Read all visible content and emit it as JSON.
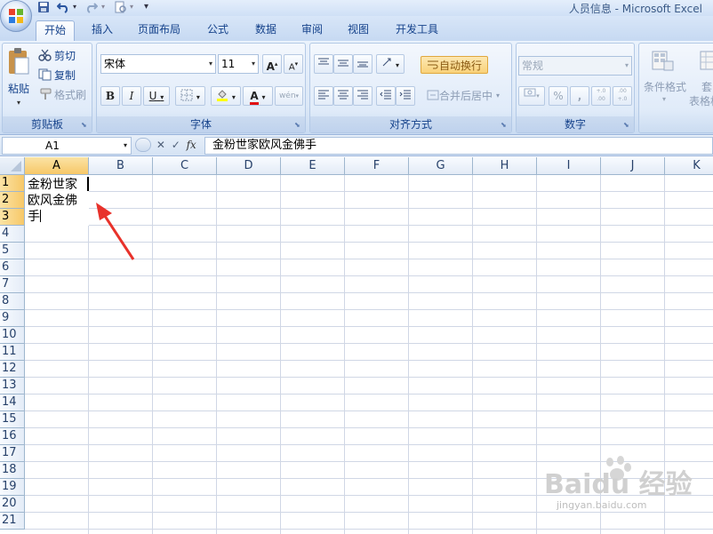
{
  "window": {
    "title": "人员信息 - Microsoft Excel"
  },
  "tabs": [
    "开始",
    "插入",
    "页面布局",
    "公式",
    "数据",
    "审阅",
    "视图",
    "开发工具"
  ],
  "active_tab": "开始",
  "ribbon": {
    "clipboard": {
      "label": "剪贴板",
      "paste": "粘贴",
      "cut": "剪切",
      "copy": "复制",
      "format_painter": "格式刷"
    },
    "font": {
      "label": "字体",
      "font_name": "宋体",
      "font_size": "11",
      "bold": "B",
      "italic": "I",
      "underline": "U",
      "grow": "A",
      "shrink": "A",
      "font_color_letter": "A",
      "wen": "wén"
    },
    "alignment": {
      "label": "对齐方式",
      "wrap_text": "自动换行",
      "merge_center": "合并后居中"
    },
    "number": {
      "label": "数字",
      "format": "常规",
      "percent": "%",
      "comma": ",",
      "inc_decimal": "+.0 .00",
      "dec_decimal": ".00 +.0"
    },
    "styles": {
      "conditional_format": "条件格式",
      "table_format_line1": "套",
      "table_format_line2": "表格格"
    }
  },
  "formula_bar": {
    "name_box": "A1",
    "fx": "fx",
    "value": "金粉世家欧风金佛手"
  },
  "grid": {
    "columns": [
      "A",
      "B",
      "C",
      "D",
      "E",
      "F",
      "G",
      "H",
      "I",
      "J",
      "K"
    ],
    "rows": [
      "1",
      "2",
      "3",
      "4",
      "5",
      "6",
      "7",
      "8",
      "9",
      "10",
      "11",
      "12",
      "13",
      "14",
      "15",
      "16",
      "17",
      "18",
      "19",
      "20",
      "21"
    ],
    "selected_column": "A",
    "selected_rows": [
      "1",
      "2",
      "3"
    ],
    "active_cell_text": "金粉世家欧风金佛手"
  },
  "watermark": {
    "brand": "Baidu 经验",
    "sub": "jingyan.baidu.com"
  },
  "colors": {
    "accent": "#15428b",
    "arrow": "#e8322b",
    "header_selected": "#f7c868"
  }
}
